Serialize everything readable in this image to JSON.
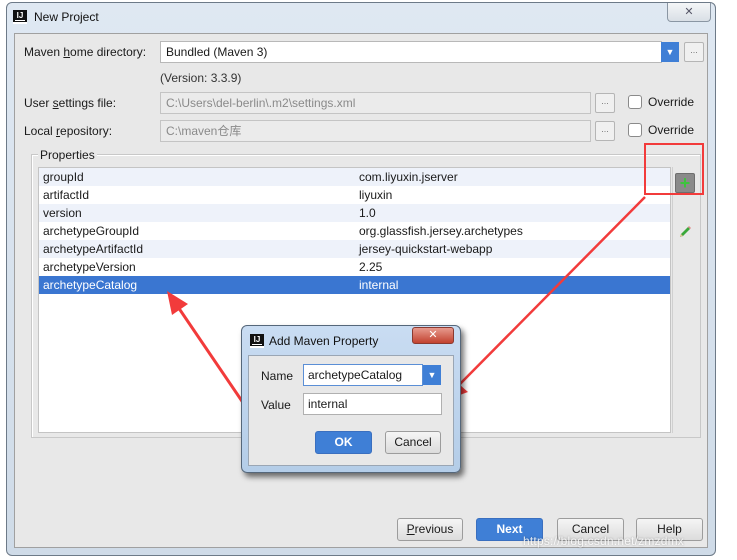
{
  "window": {
    "title": "New Project",
    "app_icon": "IJ",
    "close_glyph": "✕"
  },
  "form": {
    "maven_home": {
      "label_pre": "Maven ",
      "label_mnemonic": "h",
      "label_post": "ome directory:",
      "value": "Bundled (Maven 3)",
      "version": "(Version: 3.3.9)"
    },
    "user_settings": {
      "label_pre": "User ",
      "label_mnemonic": "s",
      "label_post": "ettings file:",
      "value": "C:\\Users\\del-berlin\\.m2\\settings.xml",
      "override_label": "Override",
      "override_checked": false
    },
    "local_repo": {
      "label_pre": "Local ",
      "label_mnemonic": "r",
      "label_post": "epository:",
      "value": "C:\\maven仓库",
      "override_label": "Override",
      "override_checked": false
    },
    "browse_glyph": "..."
  },
  "properties": {
    "legend": "Properties",
    "rows": [
      {
        "key": "groupId",
        "value": "com.liyuxin.jserver"
      },
      {
        "key": "artifactId",
        "value": "liyuxin"
      },
      {
        "key": "version",
        "value": "1.0"
      },
      {
        "key": "archetypeGroupId",
        "value": "org.glassfish.jersey.archetypes"
      },
      {
        "key": "archetypeArtifactId",
        "value": "jersey-quickstart-webapp"
      },
      {
        "key": "archetypeVersion",
        "value": "2.25"
      },
      {
        "key": "archetypeCatalog",
        "value": "internal",
        "selected": true
      }
    ],
    "add_glyph": "+"
  },
  "dialog": {
    "title": "Add Maven Property",
    "name_label": "Name",
    "name_value": "archetypeCatalog",
    "value_label": "Value",
    "value_value": "internal",
    "ok_label": "OK",
    "cancel_label": "Cancel",
    "dropdown_glyph": "▼"
  },
  "footer": {
    "previous_mnemonic": "P",
    "previous_rest": "revious",
    "next_label": "Next",
    "cancel_label": "Cancel",
    "help_label": "Help"
  },
  "watermark": "https://blog.csdn.net/zmzdmx",
  "colors": {
    "accent": "#3a76d1",
    "annotation": "#f23b3b",
    "add_icon": "#3ec43e"
  }
}
